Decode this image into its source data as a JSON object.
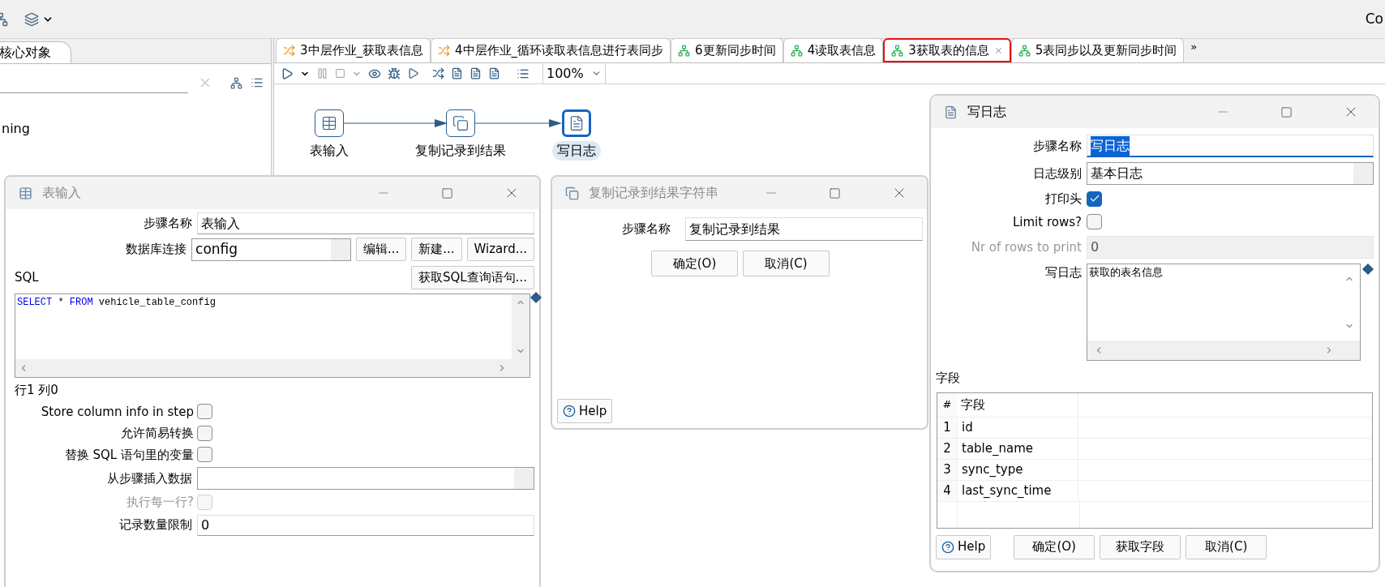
{
  "top_right_text": "Co",
  "left_panel": {
    "tab": "核心对象",
    "visible_text": "ning"
  },
  "tabs": [
    {
      "label": "3中层作业_获取表信息",
      "kind": "job",
      "selected": false
    },
    {
      "label": "4中层作业_循环读取表信息进行表同步",
      "kind": "job",
      "selected": false
    },
    {
      "label": "6更新同步时间",
      "kind": "transformation",
      "selected": false
    },
    {
      "label": "4读取表信息",
      "kind": "transformation",
      "selected": false
    },
    {
      "label": "3获取表的信息",
      "kind": "transformation",
      "selected": true
    },
    {
      "label": "5表同步以及更新同步时间",
      "kind": "transformation",
      "selected": false
    }
  ],
  "tabs_overflow": "»",
  "zoom": "100%",
  "canvas": {
    "steps": [
      {
        "label": "表输入",
        "kind": "table_input",
        "selected": false
      },
      {
        "label": "复制记录到结果",
        "kind": "copy_rows",
        "selected": false
      },
      {
        "label": "写日志",
        "kind": "write_log",
        "selected": true
      }
    ]
  },
  "table_input_dialog": {
    "title": "表输入",
    "step_name": {
      "label": "步骤名称",
      "value": "表输入"
    },
    "connection": {
      "label": "数据库连接",
      "value": "config",
      "buttons": [
        "编辑...",
        "新建...",
        "Wizard..."
      ]
    },
    "sql_label": "SQL",
    "get_sql_button": "获取SQL查询语句...",
    "sql_tokens": [
      {
        "text": "SELECT",
        "kind": "keyword"
      },
      {
        "text": "*",
        "kind": "plain"
      },
      {
        "text": "FROM",
        "kind": "keyword"
      },
      {
        "text": "vehicle_table_config",
        "kind": "plain"
      }
    ],
    "cursor_position": "行1 列0",
    "options": [
      {
        "label": "Store column info in step",
        "checked": false,
        "disabled": false
      },
      {
        "label": "允许简易转换",
        "checked": false,
        "disabled": false
      },
      {
        "label": "替换 SQL 语句里的变量",
        "checked": false,
        "disabled": false
      }
    ],
    "insert_from_step": {
      "label": "从步骤插入数据"
    },
    "execute_each_row": {
      "label": "执行每一行?",
      "checked": false,
      "disabled": true
    },
    "limit": {
      "label": "记录数量限制",
      "value": "0"
    }
  },
  "copy_rows_dialog": {
    "title": "复制记录到结果字符串",
    "step_name": {
      "label": "步骤名称",
      "value": "复制记录到结果"
    },
    "buttons": [
      "确定(O)",
      "取消(C)"
    ],
    "help": "Help"
  },
  "write_log_dialog": {
    "title": "写日志",
    "step_name": {
      "label": "步骤名称",
      "value": "写日志"
    },
    "log_level": {
      "label": "日志级别",
      "value": "基本日志"
    },
    "print_header": {
      "label": "打印头",
      "checked": true
    },
    "limit_rows": {
      "label": "Limit rows?",
      "checked": false
    },
    "rows_to_print": {
      "label": "Nr of rows to print",
      "value": "0",
      "disabled": true
    },
    "message": {
      "label": "写日志",
      "value": "获取的表名信息"
    },
    "fields_label": "字段",
    "table": {
      "columns": [
        "#",
        "字段"
      ],
      "rows": [
        [
          "1",
          "id"
        ],
        [
          "2",
          "table_name"
        ],
        [
          "3",
          "sync_type"
        ],
        [
          "4",
          "last_sync_time"
        ]
      ]
    },
    "help": "Help",
    "buttons": [
      "确定(O)",
      "获取字段",
      "取消(C)"
    ]
  }
}
